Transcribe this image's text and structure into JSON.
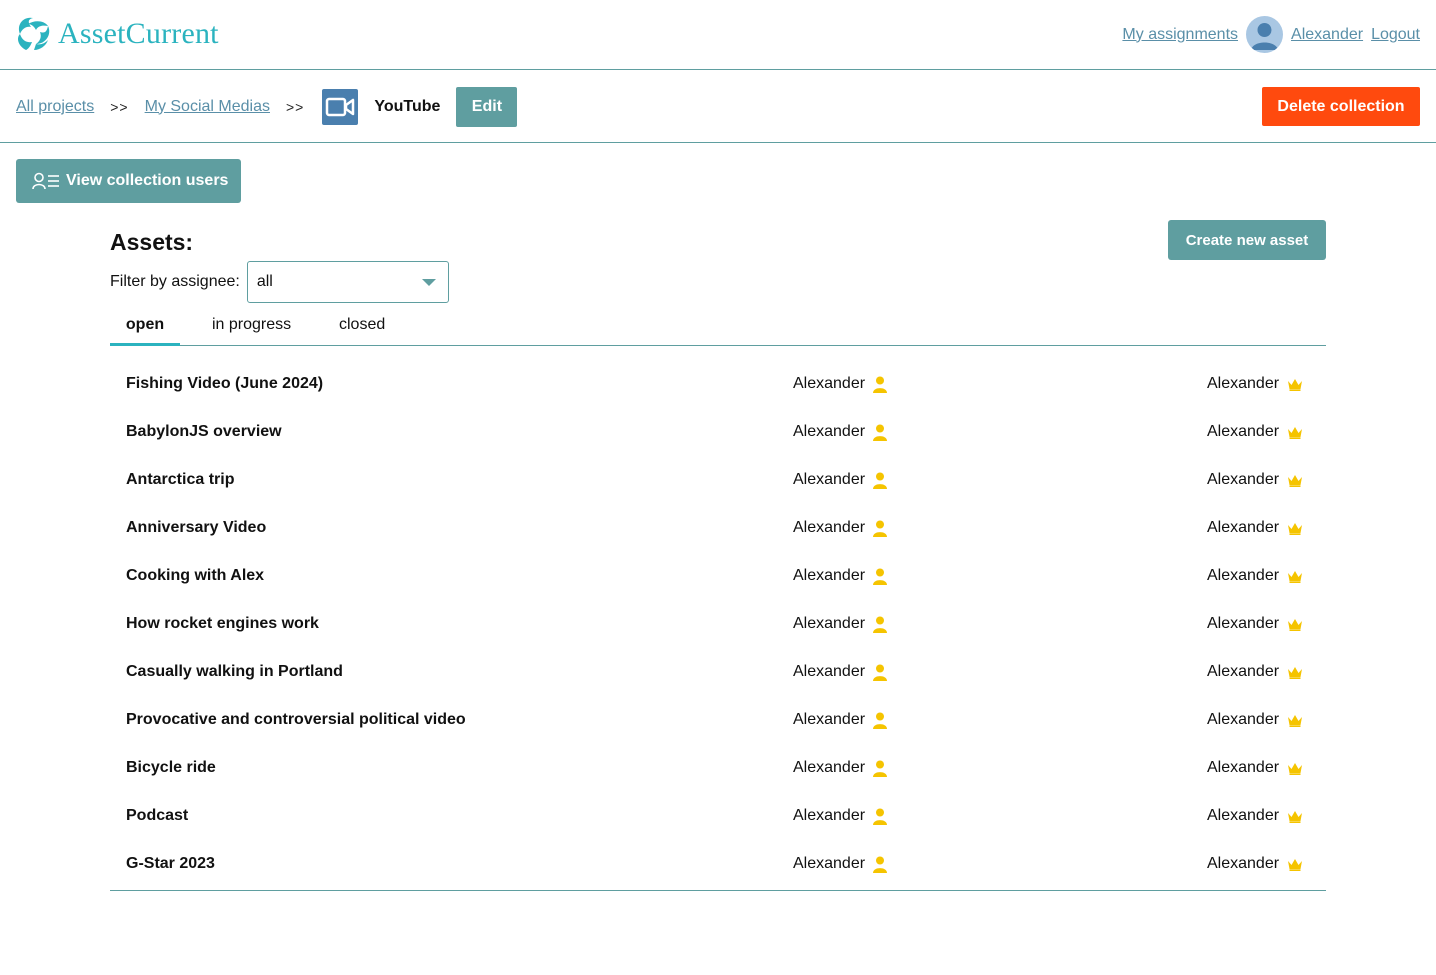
{
  "app": {
    "name": "AssetCurrent",
    "brand_color": "#2bb3bf",
    "accent_color": "#5f9ea0",
    "danger_color": "#ff4a0e"
  },
  "header": {
    "my_assignments": "My assignments",
    "user_name": "Alexander",
    "logout": "Logout"
  },
  "breadcrumb": {
    "all_projects": "All projects",
    "separator": ">>",
    "project": "My Social Medias",
    "collection": "YouTube",
    "collection_icon": "video-camera-icon",
    "edit_label": "Edit",
    "delete_label": "Delete collection"
  },
  "view_users_label": "View collection users",
  "assets": {
    "title": "Assets:",
    "create_label": "Create new asset",
    "filter_label": "Filter by assignee:",
    "filter_value": "all",
    "tabs": [
      {
        "label": "open",
        "active": true
      },
      {
        "label": "in progress",
        "active": false
      },
      {
        "label": "closed",
        "active": false
      }
    ],
    "rows": [
      {
        "title": "Fishing Video (June 2024)",
        "assignee": "Alexander",
        "owner": "Alexander"
      },
      {
        "title": "BabylonJS overview",
        "assignee": "Alexander",
        "owner": "Alexander"
      },
      {
        "title": "Antarctica trip",
        "assignee": "Alexander",
        "owner": "Alexander"
      },
      {
        "title": "Anniversary Video",
        "assignee": "Alexander",
        "owner": "Alexander"
      },
      {
        "title": "Cooking with Alex",
        "assignee": "Alexander",
        "owner": "Alexander"
      },
      {
        "title": "How rocket engines work",
        "assignee": "Alexander",
        "owner": "Alexander"
      },
      {
        "title": "Casually walking in Portland",
        "assignee": "Alexander",
        "owner": "Alexander"
      },
      {
        "title": "Provocative and controversial political video",
        "assignee": "Alexander",
        "owner": "Alexander"
      },
      {
        "title": "Bicycle ride",
        "assignee": "Alexander",
        "owner": "Alexander"
      },
      {
        "title": "Podcast",
        "assignee": "Alexander",
        "owner": "Alexander"
      },
      {
        "title": "G-Star 2023",
        "assignee": "Alexander",
        "owner": "Alexander"
      }
    ]
  }
}
